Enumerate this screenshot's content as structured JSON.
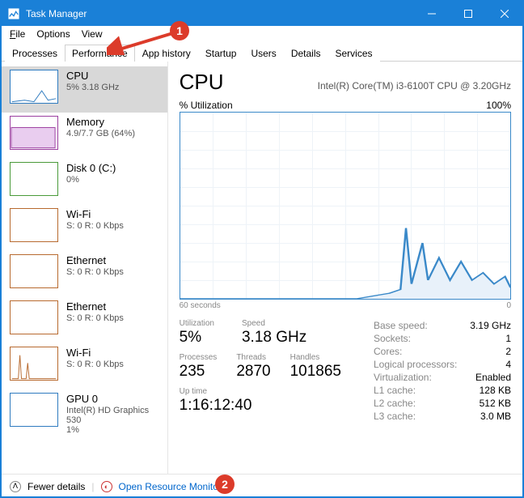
{
  "window": {
    "title": "Task Manager"
  },
  "menu": {
    "file": "File",
    "options": "Options",
    "view": "View"
  },
  "tabs": [
    "Processes",
    "Performance",
    "App history",
    "Startup",
    "Users",
    "Details",
    "Services"
  ],
  "active_tab": 1,
  "sidebar": [
    {
      "name": "CPU",
      "sub": "5% 3.18 GHz",
      "color": "#2f7bbf",
      "selected": true
    },
    {
      "name": "Memory",
      "sub": "4.9/7.7 GB (64%)",
      "color": "#9b3fa0"
    },
    {
      "name": "Disk 0 (C:)",
      "sub": "0%",
      "color": "#4a9a3a"
    },
    {
      "name": "Wi-Fi",
      "sub": "S: 0 R: 0 Kbps",
      "color": "#b86a2f"
    },
    {
      "name": "Ethernet",
      "sub": "S: 0 R: 0 Kbps",
      "color": "#b86a2f"
    },
    {
      "name": "Ethernet",
      "sub": "S: 0 R: 0 Kbps",
      "color": "#b86a2f"
    },
    {
      "name": "Wi-Fi",
      "sub": "S: 0 R: 0 Kbps",
      "color": "#b86a2f"
    },
    {
      "name": "GPU 0",
      "sub": "Intel(R) HD Graphics 530",
      "sub2": "1%",
      "color": "#2f7bbf"
    }
  ],
  "main": {
    "title": "CPU",
    "model": "Intel(R) Core(TM) i3-6100T CPU @ 3.20GHz",
    "ylabel": "% Utilization",
    "ymax": "100%",
    "xlabel_left": "60 seconds",
    "xlabel_right": "0",
    "stats_row1": [
      {
        "label": "Utilization",
        "value": "5%"
      },
      {
        "label": "Speed",
        "value": "3.18 GHz"
      }
    ],
    "stats_row2": [
      {
        "label": "Processes",
        "value": "235"
      },
      {
        "label": "Threads",
        "value": "2870"
      },
      {
        "label": "Handles",
        "value": "101865"
      }
    ],
    "uptime_label": "Up time",
    "uptime": "1:16:12:40",
    "kv": [
      {
        "k": "Base speed:",
        "v": "3.19 GHz"
      },
      {
        "k": "Sockets:",
        "v": "1"
      },
      {
        "k": "Cores:",
        "v": "2"
      },
      {
        "k": "Logical processors:",
        "v": "4"
      },
      {
        "k": "Virtualization:",
        "v": "Enabled"
      },
      {
        "k": "L1 cache:",
        "v": "128 KB"
      },
      {
        "k": "L2 cache:",
        "v": "512 KB"
      },
      {
        "k": "L3 cache:",
        "v": "3.0 MB"
      }
    ]
  },
  "footer": {
    "fewer": "Fewer details",
    "open": "Open Resource Monitor"
  },
  "annot": {
    "a1": "1",
    "a2": "2"
  },
  "chart_data": {
    "type": "line",
    "title": "% Utilization",
    "xlabel": "60 seconds",
    "ylabel": "% Utilization",
    "xlim": [
      0,
      60
    ],
    "ylim": [
      0,
      100
    ],
    "x": [
      0,
      4,
      8,
      12,
      16,
      20,
      24,
      28,
      32,
      36,
      38,
      40,
      41,
      42,
      44,
      45,
      47,
      49,
      51,
      53,
      55,
      57,
      59,
      60
    ],
    "values": [
      0,
      0,
      0,
      0,
      0,
      0,
      0,
      0,
      0,
      2,
      3,
      5,
      38,
      8,
      30,
      10,
      22,
      10,
      20,
      10,
      14,
      8,
      12,
      6
    ]
  }
}
